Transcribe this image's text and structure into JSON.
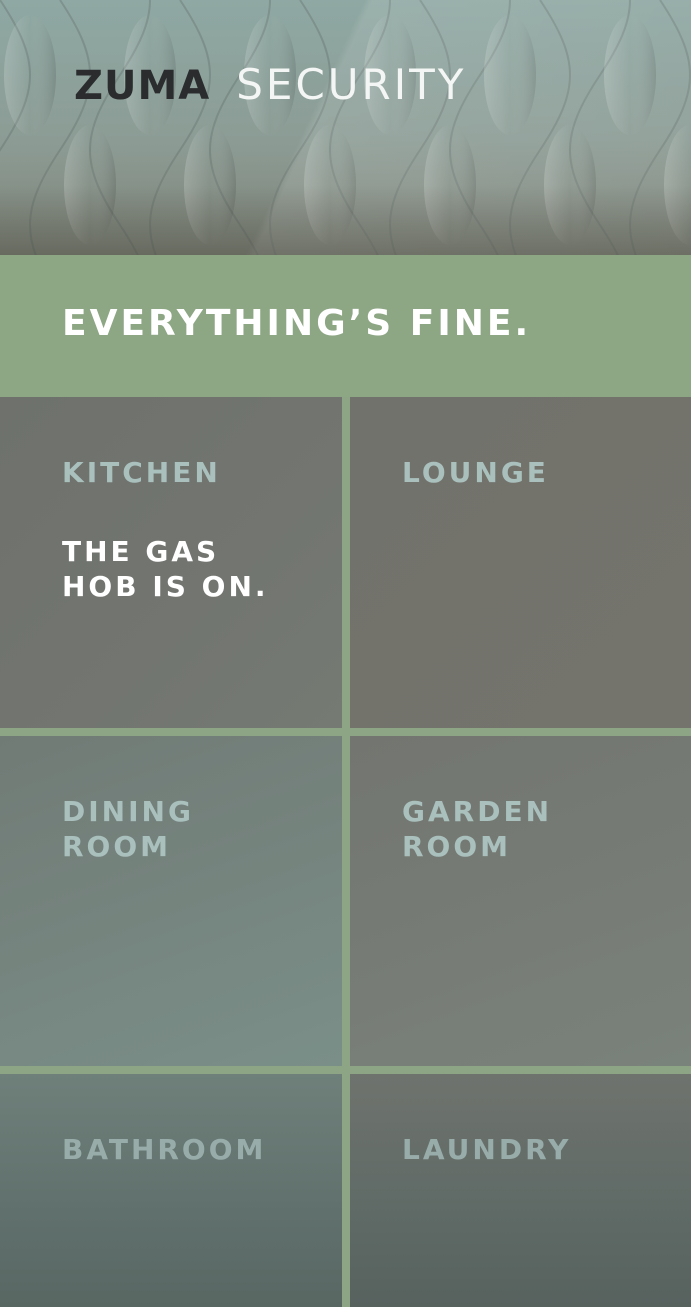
{
  "header": {
    "brand": "ZUMA",
    "product": "SECURITY"
  },
  "status": {
    "message": "EVERYTHING’S FINE."
  },
  "rooms": [
    {
      "name": "KITCHEN",
      "alert": "THE GAS\nHOB IS ON."
    },
    {
      "name": "LOUNGE",
      "alert": ""
    },
    {
      "name": "DINING\nROOM",
      "alert": ""
    },
    {
      "name": "GARDEN\nROOM",
      "alert": ""
    },
    {
      "name": "BATHROOM",
      "alert": ""
    },
    {
      "name": "LAUNDRY",
      "alert": ""
    }
  ],
  "colors": {
    "status_green": "#8da683",
    "tile_gray": "#72746e",
    "room_label": "#a9c0bd",
    "alert_text": "#ffffff"
  }
}
